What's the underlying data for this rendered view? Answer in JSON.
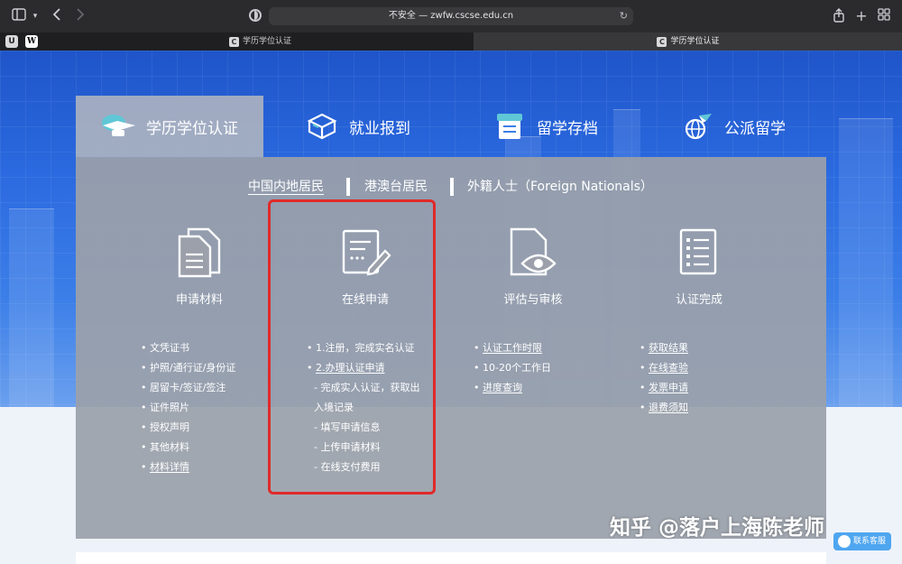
{
  "browser": {
    "url": "不安全 — zwfw.cscse.edu.cn",
    "pinned_tabs": [
      "U",
      "W"
    ],
    "tabs": [
      {
        "title": "学历学位认证",
        "favicon": "C",
        "active": false
      },
      {
        "title": "学历学位认证",
        "favicon": "C",
        "active": true
      }
    ],
    "icons": {
      "sidebar": "sidebar-icon",
      "back": "chevron-left-icon",
      "forward": "chevron-right-icon",
      "share": "share-icon",
      "new_tab": "plus-icon",
      "tab_overview": "grid-icon"
    }
  },
  "service_tabs": [
    {
      "label": "学历学位认证",
      "icon": "graduation-cap-icon",
      "active": true
    },
    {
      "label": "就业报到",
      "icon": "cube-icon",
      "active": false
    },
    {
      "label": "留学存档",
      "icon": "archive-icon",
      "active": false
    },
    {
      "label": "公派留学",
      "icon": "airplane-globe-icon",
      "active": false
    }
  ],
  "regions": [
    {
      "label": "中国内地居民",
      "selected": true
    },
    {
      "label": "港澳台居民",
      "selected": false
    },
    {
      "label": "外籍人士（Foreign Nationals）",
      "selected": false
    }
  ],
  "steps": [
    {
      "title": "申请材料",
      "icon": "documents-icon",
      "items": [
        {
          "text": "文凭证书",
          "link": false
        },
        {
          "text": "护照/通行证/身份证",
          "link": false
        },
        {
          "text": "居留卡/签证/签注",
          "link": false
        },
        {
          "text": "证件照片",
          "link": false
        },
        {
          "text": "授权声明",
          "link": false
        },
        {
          "text": "其他材料",
          "link": false
        },
        {
          "text": "材料详情",
          "link": true
        }
      ]
    },
    {
      "title": "在线申请",
      "icon": "form-edit-icon",
      "items": [
        {
          "text": "1.注册，完成实名认证",
          "link": false,
          "bullet": true
        },
        {
          "text": "2.办理认证申请",
          "link": true,
          "bullet": true
        },
        {
          "text": "- 完成实人认证，获取出",
          "link": false,
          "bullet": false
        },
        {
          "text": "入境记录",
          "link": false,
          "bullet": false
        },
        {
          "text": "- 填写申请信息",
          "link": false,
          "bullet": false
        },
        {
          "text": "- 上传申请材料",
          "link": false,
          "bullet": false
        },
        {
          "text": "- 在线支付费用",
          "link": false,
          "bullet": false
        }
      ]
    },
    {
      "title": "评估与审核",
      "icon": "document-eye-icon",
      "items": [
        {
          "text": "认证工作时限",
          "link": true
        },
        {
          "text": "10-20个工作日",
          "link": false
        },
        {
          "text": "进度查询",
          "link": true
        }
      ]
    },
    {
      "title": "认证完成",
      "icon": "checklist-icon",
      "items": [
        {
          "text": "获取结果",
          "link": true
        },
        {
          "text": "在线查验",
          "link": true
        },
        {
          "text": "发票申请",
          "link": true
        },
        {
          "text": "退费须知",
          "link": true
        }
      ]
    }
  ],
  "watermark": "知乎 @落户上海陈老师",
  "service_button": "联系客服",
  "colors": {
    "highlight": "#e02a2a",
    "panel": "#9ba0aa",
    "hero": "#2b6ae0",
    "service_button": "#4fa6f0"
  }
}
